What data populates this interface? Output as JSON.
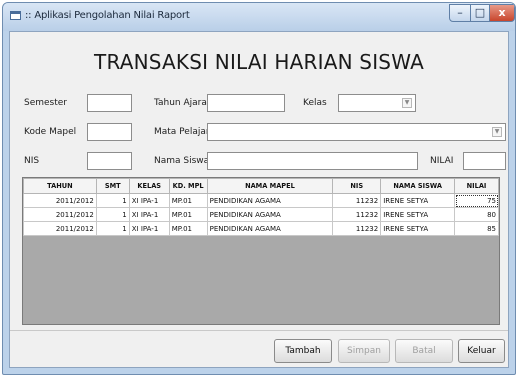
{
  "window": {
    "title": ":: Aplikasi Pengolahan Nilai Raport"
  },
  "form": {
    "heading": "TRANSAKSI NILAI HARIAN SISWA"
  },
  "fields": {
    "semester_label": "Semester",
    "tahun_ajaran_label": "Tahun Ajaran",
    "kelas_label": "Kelas",
    "kode_mapel_label": "Kode Mapel",
    "mata_pelajaran_label": "Mata Pelajaran",
    "nis_label": "NIS",
    "nama_siswa_label": "Nama Siswa",
    "nilai_label": "NILAI"
  },
  "grid": {
    "columns": [
      "TAHUN",
      "SMT",
      "KELAS",
      "KD. MPL",
      "NAMA MAPEL",
      "NIS",
      "NAMA SISWA",
      "NILAI"
    ],
    "rows": [
      [
        "2011/2012",
        "1",
        "XI IPA-1",
        "MP.01",
        "PENDIDIKAN AGAMA",
        "11232",
        "IRENE SETYA",
        "75"
      ],
      [
        "2011/2012",
        "1",
        "XI IPA-1",
        "MP.01",
        "PENDIDIKAN AGAMA",
        "11232",
        "IRENE SETYA",
        "80"
      ],
      [
        "2011/2012",
        "1",
        "XI IPA-1",
        "MP.01",
        "PENDIDIKAN AGAMA",
        "11232",
        "IRENE SETYA",
        "85"
      ]
    ]
  },
  "buttons": {
    "tambah": "Tambah",
    "simpan": "Simpan",
    "batal": "Batal",
    "keluar": "Keluar"
  },
  "window_controls": {
    "minimize": "–",
    "maximize": "□",
    "close": "x"
  }
}
